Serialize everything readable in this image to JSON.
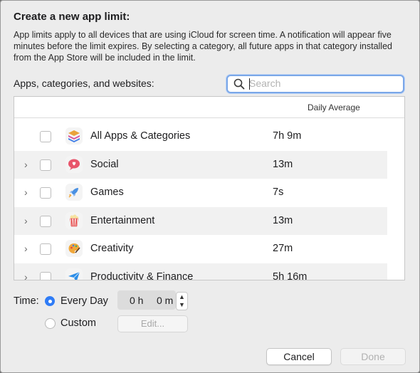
{
  "dialog": {
    "title": "Create a new app limit:",
    "description": "App limits apply to all devices that are using iCloud for screen time. A notification will appear five minutes before the limit expires. By selecting a category, all future apps in that category installed from the App Store will be included in the limit."
  },
  "picker": {
    "label": "Apps, categories, and websites:",
    "search_placeholder": "Search",
    "search_value": ""
  },
  "table": {
    "column_daily_average": "Daily Average",
    "rows": [
      {
        "name": "All Apps & Categories",
        "avg": "7h 9m",
        "expandable": false,
        "checked": false,
        "icon": "layers-icon",
        "icon_color": "#e9a23b"
      },
      {
        "name": "Social",
        "avg": "13m",
        "expandable": true,
        "checked": false,
        "icon": "chat-bubble-icon",
        "icon_color": "#e8556b"
      },
      {
        "name": "Games",
        "avg": "7s",
        "expandable": true,
        "checked": false,
        "icon": "rocket-icon",
        "icon_color": "#4a90e2"
      },
      {
        "name": "Entertainment",
        "avg": "13m",
        "expandable": true,
        "checked": false,
        "icon": "popcorn-icon",
        "icon_color": "#e23b3b"
      },
      {
        "name": "Creativity",
        "avg": "27m",
        "expandable": true,
        "checked": false,
        "icon": "palette-icon",
        "icon_color": "#f0a73a"
      },
      {
        "name": "Productivity & Finance",
        "avg": "5h 16m",
        "expandable": true,
        "checked": false,
        "icon": "paper-plane-icon",
        "icon_color": "#2b8de8"
      }
    ]
  },
  "time": {
    "label": "Time:",
    "every_day_label": "Every Day",
    "custom_label": "Custom",
    "selected": "every_day",
    "hours": "0 h",
    "minutes": "0 m",
    "edit_label": "Edit..."
  },
  "footer": {
    "cancel_label": "Cancel",
    "done_label": "Done"
  },
  "colors": {
    "accent": "#2f7cf6"
  }
}
